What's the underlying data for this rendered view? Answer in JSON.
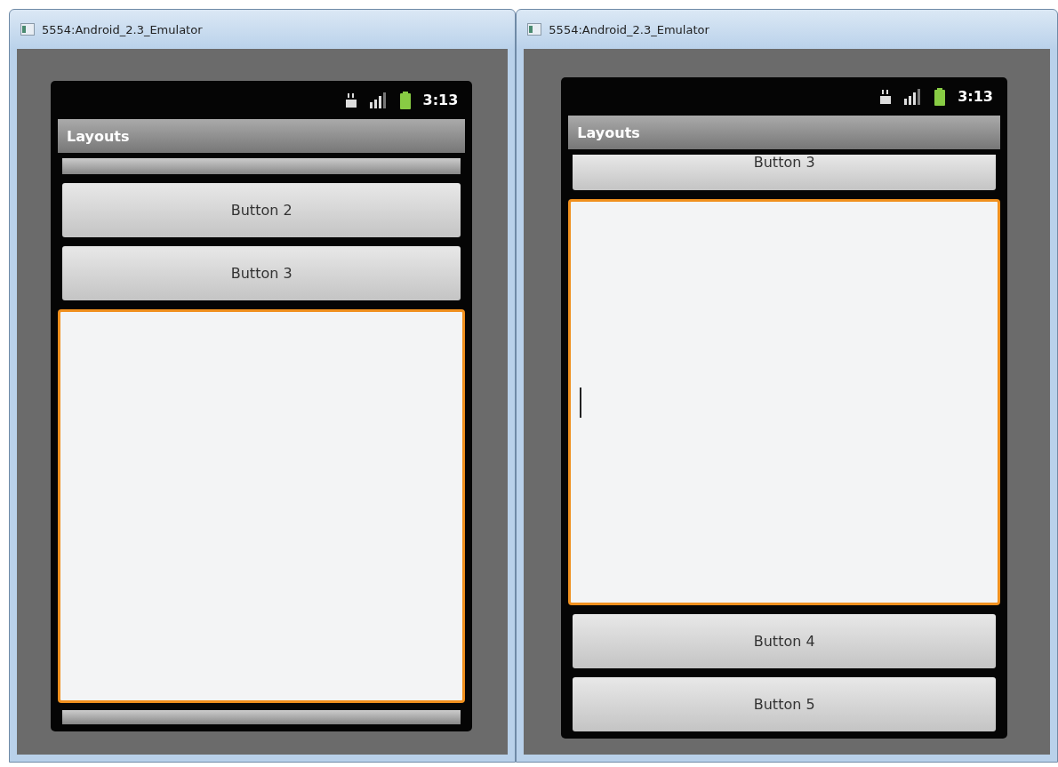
{
  "windows": [
    {
      "title": "5554:Android_2.3_Emulator",
      "status": {
        "time": "3:13"
      },
      "app_title": "Layouts",
      "items": [
        {
          "kind": "edge-top"
        },
        {
          "kind": "button",
          "label": "Button 2"
        },
        {
          "kind": "button",
          "label": "Button 3"
        },
        {
          "kind": "field",
          "focused": true,
          "cursor": false
        },
        {
          "kind": "edge-bottom"
        }
      ]
    },
    {
      "title": "5554:Android_2.3_Emulator",
      "status": {
        "time": "3:13"
      },
      "app_title": "Layouts",
      "items": [
        {
          "kind": "button-cut",
          "label": "Button 3"
        },
        {
          "kind": "field",
          "focused": true,
          "cursor": true
        },
        {
          "kind": "button",
          "label": "Button 4"
        },
        {
          "kind": "button",
          "label": "Button 5"
        }
      ]
    }
  ]
}
